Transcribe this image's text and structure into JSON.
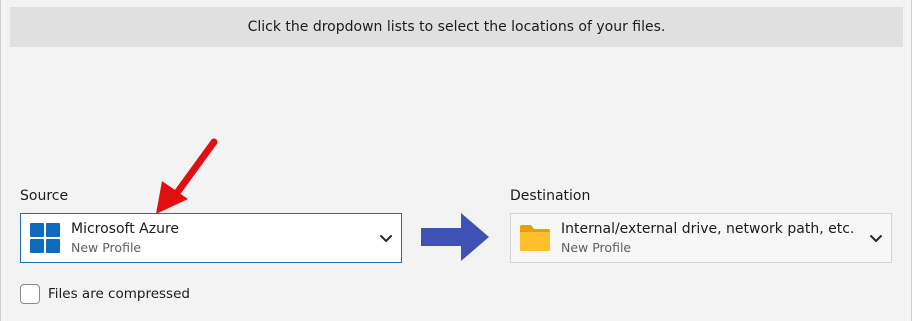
{
  "instruction": "Click the dropdown lists to select the locations of your files.",
  "source": {
    "label": "Source",
    "selected_title": "Microsoft Azure",
    "selected_subtitle": "New Profile",
    "icon": "windows-icon"
  },
  "destination": {
    "label": "Destination",
    "selected_title": "Internal/external drive, network path, etc.",
    "selected_subtitle": "New Profile",
    "icon": "folder-icon"
  },
  "files_compressed": {
    "label": "Files are compressed",
    "checked": false
  },
  "colors": {
    "source_border": "#1f6fb2",
    "windows_blue": "#0f6cbd",
    "folder_yellow": "#f7b500",
    "flow_arrow": "#3f51b5",
    "annotation_arrow": "#e01010"
  }
}
